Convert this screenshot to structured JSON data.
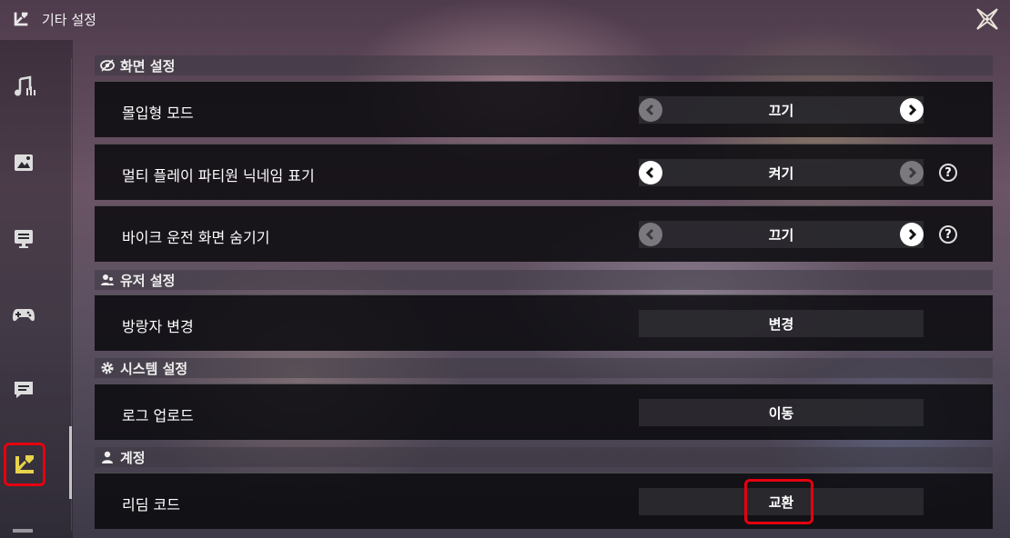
{
  "header": {
    "title": "기타 설정",
    "title_icon": "misc-settings-icon",
    "close_icon": "close-icon"
  },
  "sidebar": {
    "items": [
      {
        "name": "audio",
        "icon": "music-note-icon"
      },
      {
        "name": "graphics",
        "icon": "image-icon"
      },
      {
        "name": "display",
        "icon": "monitor-icon"
      },
      {
        "name": "controls",
        "icon": "gamepad-icon"
      },
      {
        "name": "chat",
        "icon": "chat-icon"
      },
      {
        "name": "misc",
        "icon": "misc-settings-icon",
        "active": true
      }
    ]
  },
  "sections": {
    "screen": {
      "title": "화면 설정",
      "icon": "eye-icon"
    },
    "user": {
      "title": "유저 설정",
      "icon": "user-group-icon"
    },
    "system": {
      "title": "시스템 설정",
      "icon": "gear-icon"
    },
    "account": {
      "title": "계정",
      "icon": "person-icon"
    }
  },
  "rows": {
    "immersive": {
      "label": "몰입형 모드",
      "value": "끄기"
    },
    "party_nickname": {
      "label": "멀티 플레이 파티원 닉네임 표기",
      "value": "켜기"
    },
    "hide_bike": {
      "label": "바이크 운전 화면 숨기기",
      "value": "끄기"
    },
    "wanderer": {
      "label": "방랑자 변경",
      "value": "변경"
    },
    "log_upload": {
      "label": "로그 업로드",
      "value": "이동"
    },
    "redeem": {
      "label": "리딤 코드",
      "value": "교환"
    }
  },
  "help_glyph": "?",
  "colors": {
    "highlight": "#e5000f",
    "accent_yellow": "#e8d34a"
  }
}
